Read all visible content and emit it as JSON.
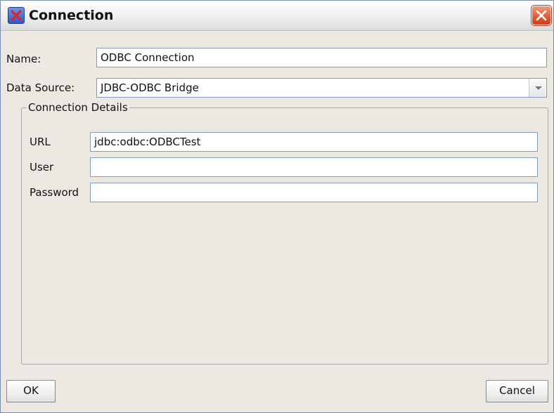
{
  "window": {
    "title": "Connection",
    "app_icon": "x-app-icon",
    "close_icon": "close-icon"
  },
  "form": {
    "name_label": "Name:",
    "name_value": "ODBC Connection",
    "datasource_label": "Data Source:",
    "datasource_value": "JDBC-ODBC Bridge"
  },
  "details": {
    "legend": "Connection Details",
    "url_label": "URL",
    "url_value": "jdbc:odbc:ODBCTest",
    "user_label": "User",
    "user_value": "",
    "password_label": "Password",
    "password_value": ""
  },
  "buttons": {
    "ok": "OK",
    "cancel": "Cancel"
  },
  "colors": {
    "title_close_accent": "#e05a34",
    "app_icon_blue": "#2f5cc8",
    "app_icon_x": "#d8262c",
    "dialog_background": "#ece9e2",
    "field_border": "#7f9db9"
  }
}
